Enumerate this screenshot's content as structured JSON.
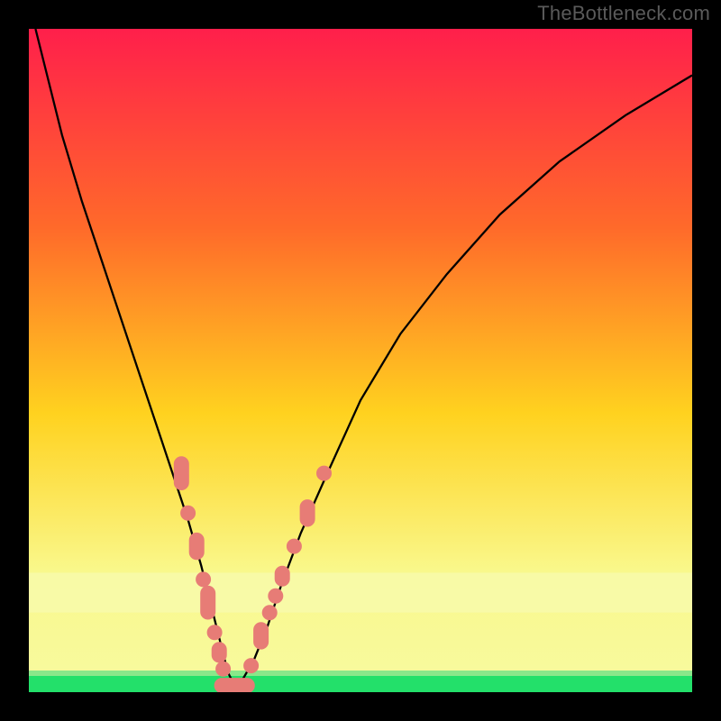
{
  "watermark": "TheBottleneck.com",
  "palette": {
    "frame": "#000000",
    "grad_top": "#ff1f4b",
    "grad_mid1": "#ff6a2a",
    "grad_mid2": "#ffd21f",
    "grad_mid3": "#f9f88c",
    "grad_band": "#f8faa0",
    "grad_green": "#23e06a",
    "curve": "#000000",
    "marker_fill": "#e77c76",
    "marker_stroke": "#e77c76"
  },
  "chart_data": {
    "type": "line",
    "title": "",
    "xlabel": "",
    "ylabel": "",
    "xlim": [
      0,
      100
    ],
    "ylim": [
      0,
      100
    ],
    "note": "No numeric axis ticks or labels visible. Values below are positions read off pixel geometry relative to plot area, 0–100 scale.",
    "series": [
      {
        "name": "curve",
        "x": [
          1,
          3,
          5,
          8,
          11,
          14,
          17,
          20,
          22,
          24,
          26,
          27.5,
          29,
          30,
          31,
          32,
          34,
          36,
          38,
          41,
          45,
          50,
          56,
          63,
          71,
          80,
          90,
          100
        ],
        "y": [
          100,
          92,
          84,
          74,
          65,
          56,
          47,
          38,
          32,
          26,
          19,
          13,
          7,
          3,
          1,
          1.5,
          5,
          10,
          16,
          24,
          33,
          44,
          54,
          63,
          72,
          80,
          87,
          93
        ]
      }
    ],
    "markers": [
      {
        "x": 23.0,
        "y": 33.0,
        "shape": "pill",
        "orient": "v",
        "len": 5
      },
      {
        "x": 24.0,
        "y": 27.0,
        "shape": "circle"
      },
      {
        "x": 25.3,
        "y": 22.0,
        "shape": "pill",
        "orient": "v",
        "len": 4
      },
      {
        "x": 26.3,
        "y": 17.0,
        "shape": "circle"
      },
      {
        "x": 27.0,
        "y": 13.5,
        "shape": "pill",
        "orient": "v",
        "len": 5
      },
      {
        "x": 28.0,
        "y": 9.0,
        "shape": "circle"
      },
      {
        "x": 28.7,
        "y": 6.0,
        "shape": "pill",
        "orient": "v",
        "len": 3
      },
      {
        "x": 29.3,
        "y": 3.5,
        "shape": "circle"
      },
      {
        "x": 31.0,
        "y": 1.0,
        "shape": "pill",
        "orient": "h",
        "len": 6
      },
      {
        "x": 33.5,
        "y": 4.0,
        "shape": "circle"
      },
      {
        "x": 35.0,
        "y": 8.5,
        "shape": "pill",
        "orient": "v",
        "len": 4
      },
      {
        "x": 36.3,
        "y": 12.0,
        "shape": "circle"
      },
      {
        "x": 37.2,
        "y": 14.5,
        "shape": "circle"
      },
      {
        "x": 38.2,
        "y": 17.5,
        "shape": "pill",
        "orient": "v",
        "len": 3
      },
      {
        "x": 40.0,
        "y": 22.0,
        "shape": "circle"
      },
      {
        "x": 42.0,
        "y": 27.0,
        "shape": "pill",
        "orient": "v",
        "len": 4
      },
      {
        "x": 44.5,
        "y": 33.0,
        "shape": "circle"
      }
    ],
    "green_band_y": [
      0,
      2.5
    ],
    "pale_band_y": [
      12,
      18
    ]
  }
}
